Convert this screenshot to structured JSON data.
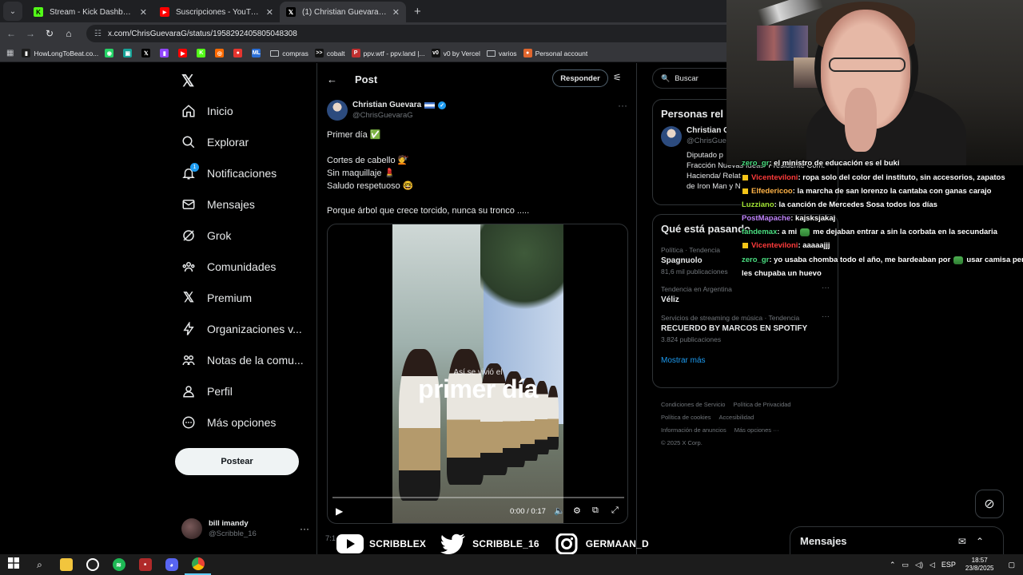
{
  "browser": {
    "tabs": [
      {
        "title": "Stream - Kick Dashboard",
        "fav_color": "#53fc18",
        "fav_glyph": "K",
        "active": false
      },
      {
        "title": "Suscripciones - YouTube",
        "fav_color": "#ff0000",
        "fav_glyph": "▶",
        "active": false
      },
      {
        "title": "(1) Christian Guevara sv en X: \"Pr",
        "fav_color": "#000000",
        "fav_glyph": "𝕏",
        "active": true
      }
    ],
    "new_tab": "+",
    "url": "x.com/ChrisGuevaraG/status/1958292405805048308",
    "bookmarks": [
      {
        "label": "HowLongToBeat.co...",
        "color": "#1d1d1d",
        "glyph": "▮"
      },
      {
        "label": "",
        "color": "#25d366",
        "glyph": "◉"
      },
      {
        "label": "",
        "color": "#17a398",
        "glyph": "▣"
      },
      {
        "label": "",
        "color": "#000000",
        "glyph": "𝕏"
      },
      {
        "label": "",
        "color": "#9146ff",
        "glyph": "▮"
      },
      {
        "label": "",
        "color": "#ff0000",
        "glyph": "▶"
      },
      {
        "label": "",
        "color": "#53fc18",
        "glyph": "K"
      },
      {
        "label": "",
        "color": "#ff6a00",
        "glyph": "◎"
      },
      {
        "label": "",
        "color": "#e5352f",
        "glyph": "●"
      },
      {
        "label": "",
        "color": "#2b6fd6",
        "glyph": "ML"
      },
      {
        "label": "compras",
        "color": "folder",
        "glyph": ""
      },
      {
        "label": "cobalt",
        "color": "#111111",
        "glyph": ">>"
      },
      {
        "label": "ppv.wtf - ppv.land |...",
        "color": "#c03030",
        "glyph": "P"
      },
      {
        "label": "v0 by Vercel",
        "color": "#111111",
        "glyph": "v0"
      },
      {
        "label": "varios",
        "color": "folder",
        "glyph": ""
      },
      {
        "label": "Personal account",
        "color": "#e0662e",
        "glyph": "●"
      }
    ]
  },
  "x": {
    "nav": [
      {
        "label": "Inicio",
        "icon": "home-icon"
      },
      {
        "label": "Explorar",
        "icon": "search-icon"
      },
      {
        "label": "Notificaciones",
        "icon": "bell-icon",
        "badge": "1"
      },
      {
        "label": "Mensajes",
        "icon": "mail-icon"
      },
      {
        "label": "Grok",
        "icon": "grok-icon"
      },
      {
        "label": "Comunidades",
        "icon": "communities-icon"
      },
      {
        "label": "Premium",
        "icon": "x-premium-icon"
      },
      {
        "label": "Organizaciones v...",
        "icon": "lightning-icon"
      },
      {
        "label": "Notas de la comu...",
        "icon": "notes-icon"
      },
      {
        "label": "Perfil",
        "icon": "person-icon"
      },
      {
        "label": "Más opciones",
        "icon": "more-circle-icon"
      }
    ],
    "post_button": "Postear",
    "account": {
      "name": "bill imandy",
      "handle": "@Scribble_16"
    },
    "header": {
      "title": "Post",
      "reply": "Responder"
    },
    "post": {
      "author_name": "Christian Guevara",
      "author_handle": "@ChrisGuevaraG",
      "lines": [
        "Primer día ✅",
        "Cortes de cabello 💇",
        "Sin maquillaje 💄",
        "Saludo respetuoso 🤓",
        "Porque árbol que crece torcido, nunca su tronco ....."
      ],
      "video": {
        "caption_small": "Así se vivió el",
        "caption_big": "primer día",
        "time": "0:00 / 0:17",
        "progress": 0
      },
      "timestamp": "7:1"
    },
    "search_placeholder": "Buscar",
    "related": {
      "title": "Personas rel",
      "name": "Christian G",
      "handle": "@ChrisGue",
      "bio": [
        "Diputado p",
        "Fracción Nuevas Ideas/ Presidente Com.",
        "Hacienda/ Relat",
        "de Iron Man y N"
      ]
    },
    "trending": {
      "title": "Qué está pasando",
      "items": [
        {
          "category": "Política · Tendencia",
          "name": "Spagnuolo",
          "count": "81,6 mil publicaciones"
        },
        {
          "category": "Tendencia en Argentina",
          "name": "Véliz",
          "count": ""
        },
        {
          "category": "Servicios de streaming de música · Tendencia",
          "name": "RECUERDO BY MARCOS EN SPOTIFY",
          "count": "3.824 publicaciones"
        }
      ],
      "show_more": "Mostrar más"
    },
    "footer": {
      "row1": [
        "Condiciones de Servicio",
        "Política de Privacidad"
      ],
      "row2": [
        "Política de cookies",
        "Accesibilidad"
      ],
      "row3": [
        "Información de anuncios",
        "Más opciones ···"
      ],
      "copyright": "© 2025 X Corp."
    },
    "messages": "Mensajes"
  },
  "chat": [
    {
      "user": "zero_gr",
      "color": "#4ade80",
      "badge": false,
      "text": ": el ministro de educación es el buki",
      "emote": false,
      "text2": ""
    },
    {
      "user": "Vicenteviloni",
      "color": "#ff3b3b",
      "badge": true,
      "text": ": ropa solo del color del instituto, sin accesorios, zapatos",
      "emote": false,
      "text2": ""
    },
    {
      "user": "Elfedericoo",
      "color": "#ffb347",
      "badge": true,
      "text": ": la marcha de san lorenzo la cantaba con ganas carajo",
      "emote": false,
      "text2": ""
    },
    {
      "user": "Luzziano",
      "color": "#a3e635",
      "badge": false,
      "text": ": la canción de Mercedes Sosa todos los días",
      "emote": false,
      "text2": ""
    },
    {
      "user": "PostMapache",
      "color": "#c084fc",
      "badge": false,
      "text": ": kajsksjakaj",
      "emote": false,
      "text2": ""
    },
    {
      "user": "fandemax",
      "color": "#4ade80",
      "badge": false,
      "text": ": a mi",
      "emote": true,
      "text2": "me dejaban entrar a sin la corbata en la secundaria"
    },
    {
      "user": "Vicenteviloni",
      "color": "#ff3b3b",
      "badge": true,
      "text": ": aaaaajjj",
      "emote": false,
      "text2": ""
    },
    {
      "user": "zero_gr",
      "color": "#4ade80",
      "badge": false,
      "text": ": yo usaba chomba todo el año, me bardeaban por",
      "emote": true,
      "text2": "usar camisa pero"
    },
    {
      "user": "",
      "color": "#ffffff",
      "badge": false,
      "text": "les chupaba un huevo",
      "emote": false,
      "text2": ""
    }
  ],
  "social": [
    {
      "label": "SCRIBBLEX",
      "icon": "youtube-icon"
    },
    {
      "label": "SCRIBBLE_16",
      "icon": "twitter-icon"
    },
    {
      "label": "GERMAAN_D",
      "icon": "instagram-icon"
    }
  ],
  "taskbar": {
    "lang": "ESP",
    "time": "18:57",
    "date": "23/8/2025"
  }
}
